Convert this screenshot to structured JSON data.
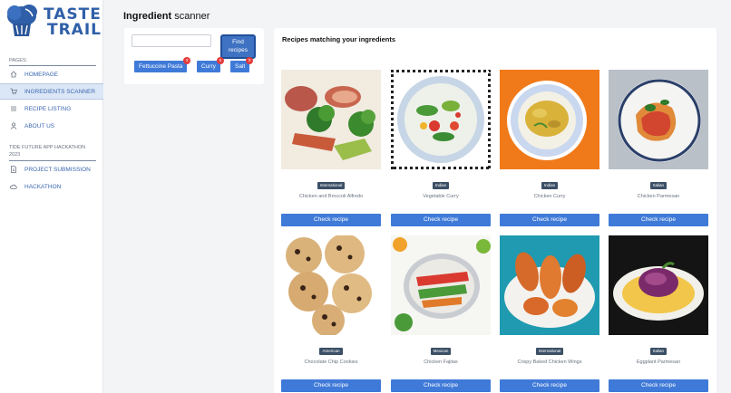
{
  "brand": {
    "line1": "TASTE",
    "line2": "TRAIL"
  },
  "sidebar": {
    "pages_label": "PAGES:",
    "items": [
      {
        "label": "HOMEPAGE",
        "icon": "home-icon"
      },
      {
        "label": "INGREDIENTS SCANNER",
        "icon": "cart-icon",
        "active": true
      },
      {
        "label": "RECIPE LISTING",
        "icon": "list-icon"
      },
      {
        "label": "ABOUT US",
        "icon": "user-icon"
      }
    ],
    "hackathon_label": "TIDE FUTURE APP HACKATHON 2023",
    "hackathon_items": [
      {
        "label": "PROJECT SUBMISSION",
        "icon": "document-icon"
      },
      {
        "label": "HACKATHON",
        "icon": "cloud-icon"
      }
    ]
  },
  "header": {
    "title_bold": "Ingredient",
    "title_rest": " scanner"
  },
  "scanner": {
    "input_value": "",
    "find_label_1": "Find",
    "find_label_2": "recipes",
    "chips": [
      "Fettuccine Pasta",
      "Curry",
      "Salt"
    ],
    "chip_remove_glyph": "x"
  },
  "recipes": {
    "title": "Recipes matching your ingredients",
    "button_label": "Check recipe",
    "cards": [
      {
        "badge": "International",
        "name": "Chicken and Broccoli Alfredo"
      },
      {
        "badge": "Indian",
        "name": "Vegetable Curry"
      },
      {
        "badge": "Indian",
        "name": "Chicken Curry"
      },
      {
        "badge": "Italian",
        "name": "Chicken Parmesan"
      },
      {
        "badge": "American",
        "name": "Chocolate Chip Cookies"
      },
      {
        "badge": "Mexican",
        "name": "Chicken Fajitas"
      },
      {
        "badge": "International",
        "name": "Crispy Baked Chicken Wings"
      },
      {
        "badge": "Italian",
        "name": "Eggplant Parmesan"
      }
    ]
  },
  "colors": {
    "accent": "#3f7ad8",
    "nav_text": "#3a66b0",
    "badge": "#3b4f66",
    "remove": "#e23b3b"
  }
}
